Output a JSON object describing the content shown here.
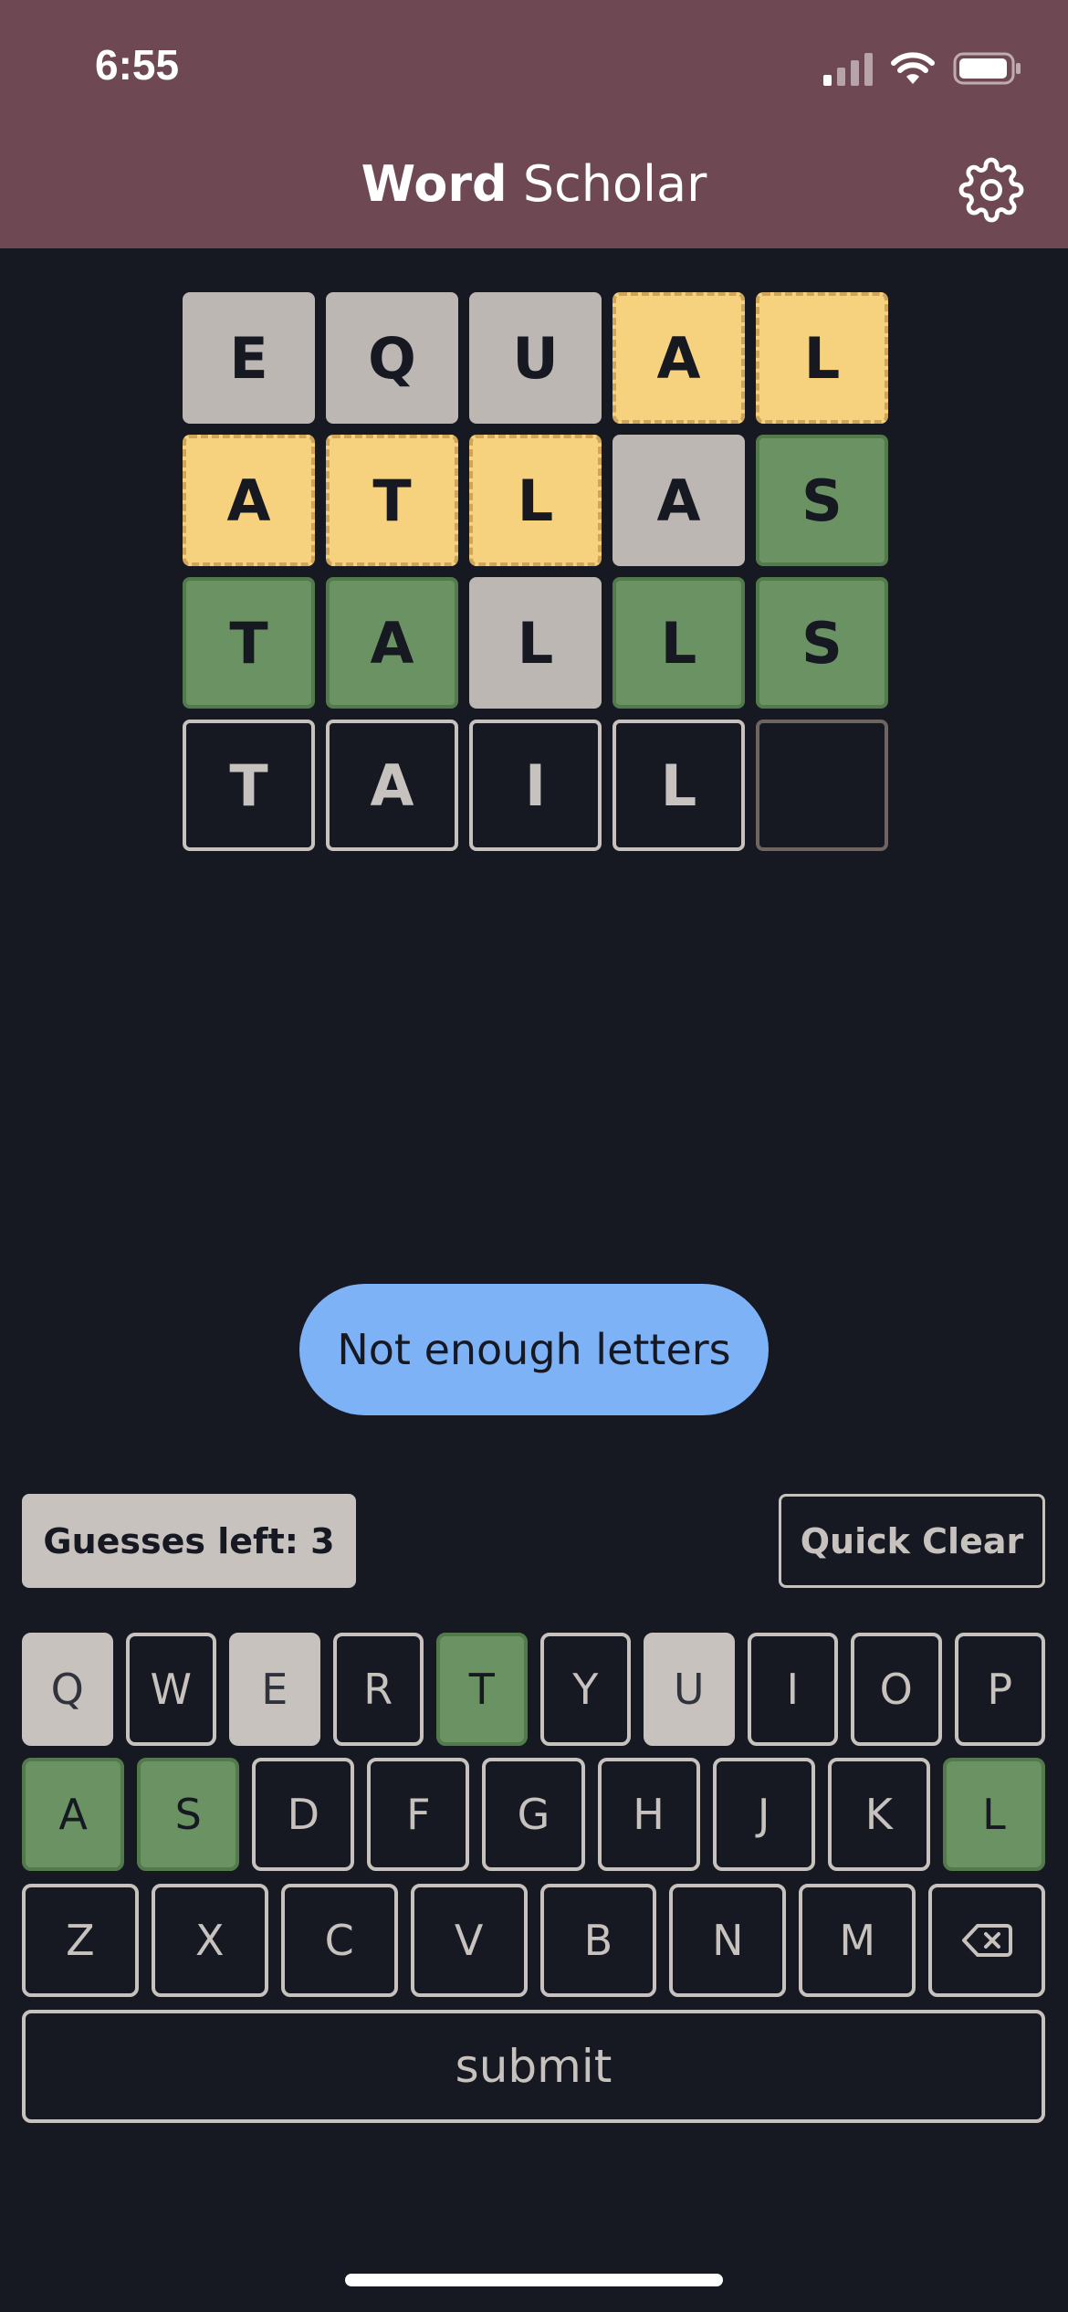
{
  "status_bar": {
    "time": "6:55"
  },
  "header": {
    "title_bold": "Word",
    "title_light": "Scholar",
    "background": "#6e4954",
    "settings_icon": "gear-icon"
  },
  "board": {
    "rows": [
      [
        {
          "l": "E",
          "s": "absent"
        },
        {
          "l": "Q",
          "s": "absent"
        },
        {
          "l": "U",
          "s": "absent"
        },
        {
          "l": "A",
          "s": "present"
        },
        {
          "l": "L",
          "s": "present"
        }
      ],
      [
        {
          "l": "A",
          "s": "present"
        },
        {
          "l": "T",
          "s": "present"
        },
        {
          "l": "L",
          "s": "present"
        },
        {
          "l": "A",
          "s": "absent"
        },
        {
          "l": "S",
          "s": "correct"
        }
      ],
      [
        {
          "l": "T",
          "s": "correct"
        },
        {
          "l": "A",
          "s": "correct"
        },
        {
          "l": "L",
          "s": "absent"
        },
        {
          "l": "L",
          "s": "correct"
        },
        {
          "l": "S",
          "s": "correct"
        }
      ],
      [
        {
          "l": "T",
          "s": "typed"
        },
        {
          "l": "A",
          "s": "typed"
        },
        {
          "l": "I",
          "s": "typed"
        },
        {
          "l": "L",
          "s": "typed"
        },
        {
          "l": "",
          "s": "empty"
        }
      ]
    ]
  },
  "toast": {
    "message": "Not enough letters"
  },
  "controls": {
    "guesses_left_label": "Guesses left: 3",
    "quick_clear_label": "Quick Clear"
  },
  "keyboard": {
    "rows": [
      [
        {
          "k": "Q",
          "s": "absent"
        },
        {
          "k": "W",
          "s": ""
        },
        {
          "k": "E",
          "s": "absent"
        },
        {
          "k": "R",
          "s": ""
        },
        {
          "k": "T",
          "s": "correct"
        },
        {
          "k": "Y",
          "s": ""
        },
        {
          "k": "U",
          "s": "absent"
        },
        {
          "k": "I",
          "s": ""
        },
        {
          "k": "O",
          "s": ""
        },
        {
          "k": "P",
          "s": ""
        }
      ],
      [
        {
          "k": "A",
          "s": "correct"
        },
        {
          "k": "S",
          "s": "correct"
        },
        {
          "k": "D",
          "s": ""
        },
        {
          "k": "F",
          "s": ""
        },
        {
          "k": "G",
          "s": ""
        },
        {
          "k": "H",
          "s": ""
        },
        {
          "k": "J",
          "s": ""
        },
        {
          "k": "K",
          "s": ""
        },
        {
          "k": "L",
          "s": "correct"
        }
      ],
      [
        {
          "k": "Z",
          "s": ""
        },
        {
          "k": "X",
          "s": ""
        },
        {
          "k": "C",
          "s": ""
        },
        {
          "k": "V",
          "s": ""
        },
        {
          "k": "B",
          "s": ""
        },
        {
          "k": "N",
          "s": ""
        },
        {
          "k": "M",
          "s": ""
        },
        {
          "k": "",
          "s": "",
          "icon": "backspace-icon"
        }
      ]
    ],
    "submit_label": "submit"
  },
  "colors": {
    "background": "#161922",
    "correct": "#6b9262",
    "present": "#f6d27e",
    "absent": "#bdb7b3",
    "toast": "#7eb2f7"
  }
}
